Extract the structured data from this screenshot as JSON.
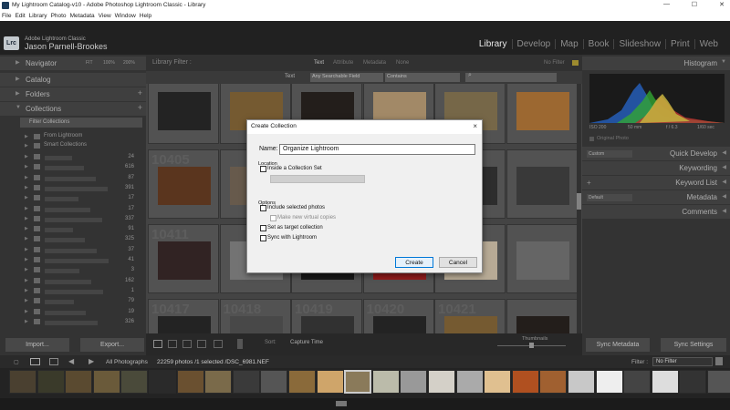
{
  "window": {
    "title": "My Lightroom Catalog-v10 - Adobe Photoshop Lightroom Classic - Library"
  },
  "menu": [
    "File",
    "Edit",
    "Library",
    "Photo",
    "Metadata",
    "View",
    "Window",
    "Help"
  ],
  "identity": {
    "badge": "Lrc",
    "app": "Adobe Lightroom Classic",
    "user": "Jason Parnell-Brookes"
  },
  "modules": [
    {
      "label": "Library",
      "active": true
    },
    {
      "label": "Develop"
    },
    {
      "label": "Map"
    },
    {
      "label": "Book"
    },
    {
      "label": "Slideshow"
    },
    {
      "label": "Print"
    },
    {
      "label": "Web"
    }
  ],
  "left": {
    "navigator": "Navigator",
    "nav_fit": "FIT",
    "nav_100": "100%",
    "nav_200": "200%",
    "catalog": "Catalog",
    "folders": "Folders",
    "collections": "Collections",
    "filter_collections": "Filter Collections",
    "from_lightroom": "From Lightroom",
    "smart_collections": "Smart Collections",
    "counts": [
      "24",
      "616",
      "87",
      "391",
      "17",
      "17",
      "337",
      "91",
      "325",
      "37",
      "41",
      "3",
      "162",
      "1",
      "79",
      "19",
      "326"
    ],
    "import": "Import...",
    "export": "Export..."
  },
  "center": {
    "library_filter": "Library Filter :",
    "filter_tabs": [
      "Text",
      "Attribute",
      "Metadata",
      "None"
    ],
    "no_filter": "No Filter",
    "text_label": "Text",
    "field_select": "Any Searchable Field",
    "rule_select": "Contains",
    "grid_numbers": [
      "10405",
      "10411",
      "10417",
      "10418",
      "10419",
      "10420",
      "10421"
    ],
    "sort_label": "Sort:",
    "sort_value": "Capture Time",
    "thumbnails": "Thumbnails"
  },
  "right": {
    "histogram": "Histogram",
    "iso": "ISO 200",
    "focal": "50 mm",
    "aperture": "f / 6.3",
    "shutter": "1/60 sec",
    "original_photo": "Original Photo",
    "quick_develop": "Quick Develop",
    "custom": "Custom",
    "keywording": "Keywording",
    "keyword_list": "Keyword List",
    "metadata": "Metadata",
    "default": "Default",
    "comments": "Comments",
    "sync_metadata": "Sync Metadata",
    "sync_settings": "Sync Settings"
  },
  "filmstrip": {
    "source": "All Photographs",
    "info": "22259 photos /1 selected /DSC_6981.NEF",
    "filter_label": "Filter :",
    "filter_value": "No Filter"
  },
  "dialog": {
    "title": "Create Collection",
    "close": "×",
    "name_label": "Name:",
    "name_value": "Organize Lightroom",
    "location_label": "Location",
    "inside_set": "Inside a Collection Set",
    "options_label": "Options",
    "include_selected": "Include selected photos",
    "make_virtual": "Make new virtual copies",
    "set_target": "Set as target collection",
    "sync": "Sync with Lightroom",
    "create": "Create",
    "cancel": "Cancel"
  }
}
